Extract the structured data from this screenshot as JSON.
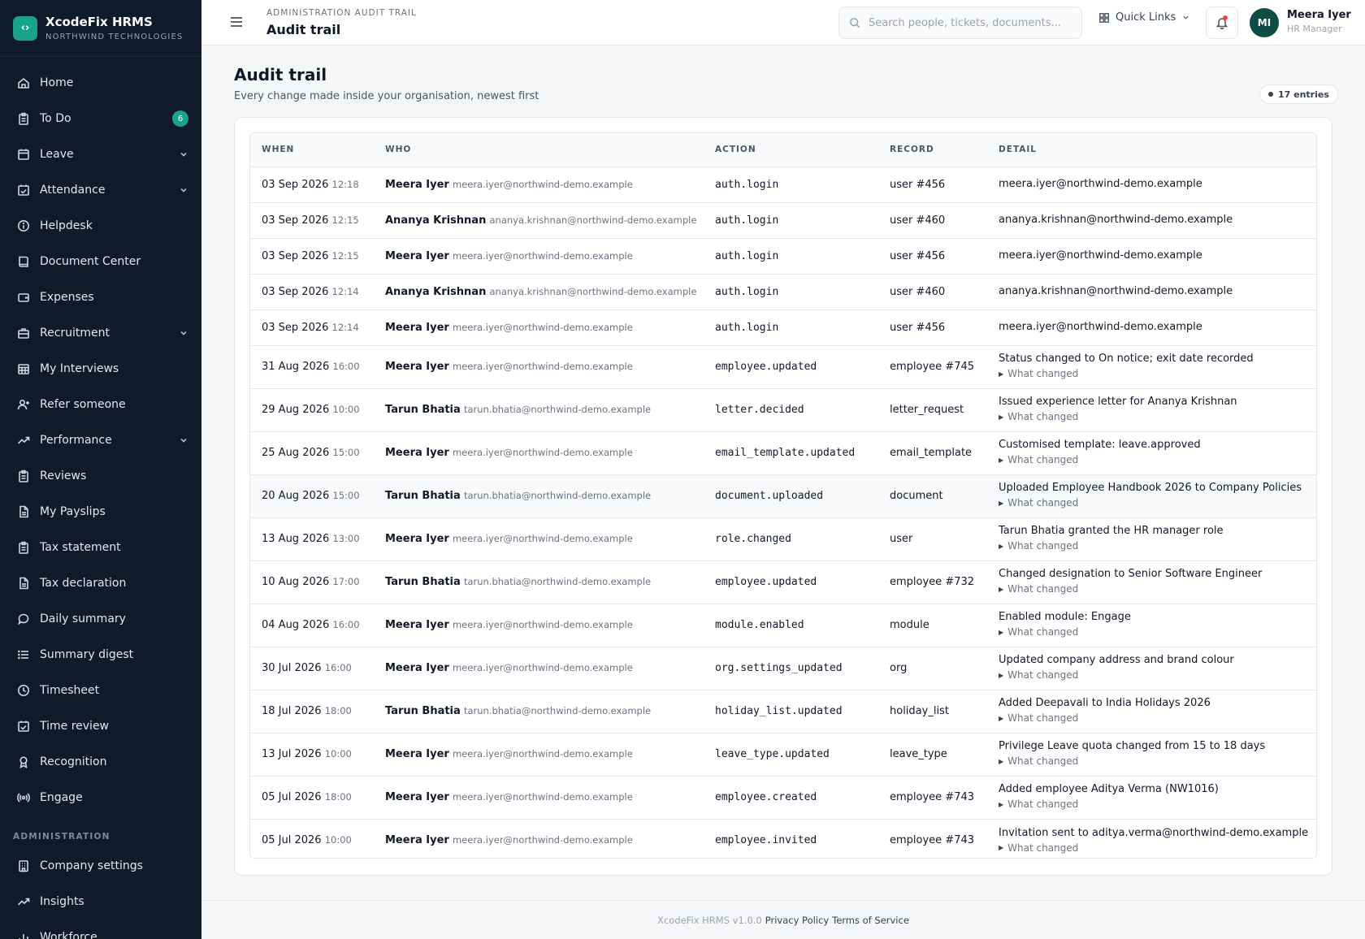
{
  "brand": {
    "name": "XcodeFix HRMS",
    "org": "NORTHWIND TECHNOLOGIES",
    "logo_icon": "code-brackets-icon"
  },
  "sidebar": {
    "items": [
      {
        "label": "Home",
        "icon": "home-icon"
      },
      {
        "label": "To Do",
        "icon": "clipboard-icon",
        "badge": "6"
      },
      {
        "label": "Leave",
        "icon": "calendar-icon",
        "chevron": true
      },
      {
        "label": "Attendance",
        "icon": "calendar-check-icon",
        "chevron": true
      },
      {
        "label": "Helpdesk",
        "icon": "info-circle-icon"
      },
      {
        "label": "Document Center",
        "icon": "book-icon"
      },
      {
        "label": "Expenses",
        "icon": "wallet-icon"
      },
      {
        "label": "Recruitment",
        "icon": "briefcase-icon",
        "chevron": true
      },
      {
        "label": "My Interviews",
        "icon": "calendar-grid-icon"
      },
      {
        "label": "Refer someone",
        "icon": "user-plus-icon"
      },
      {
        "label": "Performance",
        "icon": "trend-up-icon",
        "chevron": true
      },
      {
        "label": "Reviews",
        "icon": "clipboard-icon"
      },
      {
        "label": "My Payslips",
        "icon": "file-icon"
      },
      {
        "label": "Tax statement",
        "icon": "clipboard-icon"
      },
      {
        "label": "Tax declaration",
        "icon": "file-icon"
      },
      {
        "label": "Daily summary",
        "icon": "chat-bubble-icon"
      },
      {
        "label": "Summary digest",
        "icon": "list-icon"
      },
      {
        "label": "Timesheet",
        "icon": "clock-icon"
      },
      {
        "label": "Time review",
        "icon": "calendar-check-icon"
      },
      {
        "label": "Recognition",
        "icon": "award-icon"
      },
      {
        "label": "Engage",
        "icon": "broadcast-icon"
      }
    ],
    "admin_section": "ADMINISTRATION",
    "admin_items": [
      {
        "label": "Company settings",
        "icon": "building-icon"
      },
      {
        "label": "Insights",
        "icon": "trend-up-icon"
      },
      {
        "label": "Workforce",
        "icon": "bar-chart-icon"
      }
    ]
  },
  "topbar": {
    "breadcrumb": "ADMINISTRATION AUDIT TRAIL",
    "title": "Audit trail",
    "search_placeholder": "Search people, tickets, documents...",
    "quick_links": "Quick Links",
    "user": {
      "initials": "MI",
      "name": "Meera Iyer",
      "role": "HR Manager"
    }
  },
  "page": {
    "title": "Audit trail",
    "subtitle": "Every change made inside your organisation, newest first",
    "entries_badge": "17 entries"
  },
  "table": {
    "columns": [
      "WHEN",
      "WHO",
      "ACTION",
      "RECORD",
      "DETAIL"
    ],
    "toggle_label": "What changed",
    "rows": [
      {
        "date": "03 Sep 2026",
        "time": "12:18",
        "name": "Meera Iyer",
        "email": "meera.iyer@northwind-demo.example",
        "action": "auth.login",
        "record": "user #456",
        "detail": "meera.iyer@northwind-demo.example",
        "expandable": false
      },
      {
        "date": "03 Sep 2026",
        "time": "12:15",
        "name": "Ananya Krishnan",
        "email": "ananya.krishnan@northwind-demo.example",
        "action": "auth.login",
        "record": "user #460",
        "detail": "ananya.krishnan@northwind-demo.example",
        "expandable": false
      },
      {
        "date": "03 Sep 2026",
        "time": "12:15",
        "name": "Meera Iyer",
        "email": "meera.iyer@northwind-demo.example",
        "action": "auth.login",
        "record": "user #456",
        "detail": "meera.iyer@northwind-demo.example",
        "expandable": false
      },
      {
        "date": "03 Sep 2026",
        "time": "12:14",
        "name": "Ananya Krishnan",
        "email": "ananya.krishnan@northwind-demo.example",
        "action": "auth.login",
        "record": "user #460",
        "detail": "ananya.krishnan@northwind-demo.example",
        "expandable": false
      },
      {
        "date": "03 Sep 2026",
        "time": "12:14",
        "name": "Meera Iyer",
        "email": "meera.iyer@northwind-demo.example",
        "action": "auth.login",
        "record": "user #456",
        "detail": "meera.iyer@northwind-demo.example",
        "expandable": false
      },
      {
        "date": "31 Aug 2026",
        "time": "16:00",
        "name": "Meera Iyer",
        "email": "meera.iyer@northwind-demo.example",
        "action": "employee.updated",
        "record": "employee #745",
        "detail": "Status changed to On notice; exit date recorded",
        "expandable": true
      },
      {
        "date": "29 Aug 2026",
        "time": "10:00",
        "name": "Tarun Bhatia",
        "email": "tarun.bhatia@northwind-demo.example",
        "action": "letter.decided",
        "record": "letter_request",
        "detail": "Issued experience letter for Ananya Krishnan",
        "expandable": true
      },
      {
        "date": "25 Aug 2026",
        "time": "15:00",
        "name": "Meera Iyer",
        "email": "meera.iyer@northwind-demo.example",
        "action": "email_template.updated",
        "record": "email_template",
        "detail": "Customised template: leave.approved",
        "expandable": true
      },
      {
        "date": "20 Aug 2026",
        "time": "15:00",
        "name": "Tarun Bhatia",
        "email": "tarun.bhatia@northwind-demo.example",
        "action": "document.uploaded",
        "record": "document",
        "detail": "Uploaded Employee Handbook 2026 to Company Policies",
        "expandable": true,
        "highlight": true
      },
      {
        "date": "13 Aug 2026",
        "time": "13:00",
        "name": "Meera Iyer",
        "email": "meera.iyer@northwind-demo.example",
        "action": "role.changed",
        "record": "user",
        "detail": "Tarun Bhatia granted the HR manager role",
        "expandable": true
      },
      {
        "date": "10 Aug 2026",
        "time": "17:00",
        "name": "Tarun Bhatia",
        "email": "tarun.bhatia@northwind-demo.example",
        "action": "employee.updated",
        "record": "employee #732",
        "detail": "Changed designation to Senior Software Engineer",
        "expandable": true
      },
      {
        "date": "04 Aug 2026",
        "time": "16:00",
        "name": "Meera Iyer",
        "email": "meera.iyer@northwind-demo.example",
        "action": "module.enabled",
        "record": "module",
        "detail": "Enabled module: Engage",
        "expandable": true
      },
      {
        "date": "30 Jul 2026",
        "time": "16:00",
        "name": "Meera Iyer",
        "email": "meera.iyer@northwind-demo.example",
        "action": "org.settings_updated",
        "record": "org",
        "detail": "Updated company address and brand colour",
        "expandable": true
      },
      {
        "date": "18 Jul 2026",
        "time": "18:00",
        "name": "Tarun Bhatia",
        "email": "tarun.bhatia@northwind-demo.example",
        "action": "holiday_list.updated",
        "record": "holiday_list",
        "detail": "Added Deepavali to India Holidays 2026",
        "expandable": true
      },
      {
        "date": "13 Jul 2026",
        "time": "10:00",
        "name": "Meera Iyer",
        "email": "meera.iyer@northwind-demo.example",
        "action": "leave_type.updated",
        "record": "leave_type",
        "detail": "Privilege Leave quota changed from 15 to 18 days",
        "expandable": true
      },
      {
        "date": "05 Jul 2026",
        "time": "18:00",
        "name": "Meera Iyer",
        "email": "meera.iyer@northwind-demo.example",
        "action": "employee.created",
        "record": "employee #743",
        "detail": "Added employee Aditya Verma (NW1016)",
        "expandable": true
      },
      {
        "date": "05 Jul 2026",
        "time": "10:00",
        "name": "Meera Iyer",
        "email": "meera.iyer@northwind-demo.example",
        "action": "employee.invited",
        "record": "employee #743",
        "detail": "Invitation sent to aditya.verma@northwind-demo.example",
        "expandable": true
      }
    ]
  },
  "footer": {
    "version": "XcodeFix HRMS v1.0.0",
    "privacy": "Privacy Policy",
    "terms": "Terms of Service"
  },
  "colors": {
    "sidebar_bg": "#0f1a2a",
    "accent": "#1aa38c",
    "avatar_bg": "#0f4c46",
    "alert": "#ef4444"
  }
}
